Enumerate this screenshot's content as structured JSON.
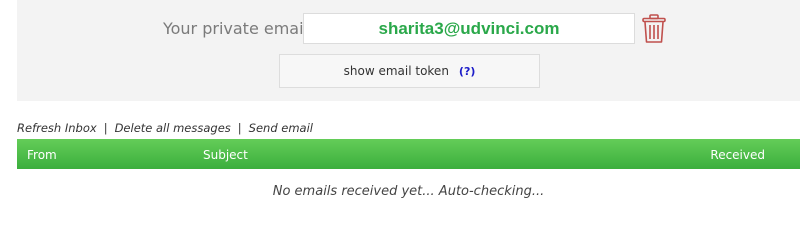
{
  "email_panel": {
    "label": "Your private email",
    "email_value": "sharita3@udvinci.com",
    "delete_icon": "trash-icon",
    "token_button_label": "show email token",
    "token_help_label": "(?)"
  },
  "actions": {
    "refresh_label": "Refresh Inbox",
    "delete_all_label": "Delete all messages",
    "send_label": "Send email",
    "separator": "|"
  },
  "table": {
    "columns": [
      "From",
      "Subject",
      "Received"
    ],
    "empty_message": "No emails received yet... Auto-checking..."
  },
  "colors": {
    "email_text": "#2aa84a",
    "header_green": "#4cbd48",
    "help_link": "#1d1dc9",
    "trash_red": "#c0504d"
  }
}
